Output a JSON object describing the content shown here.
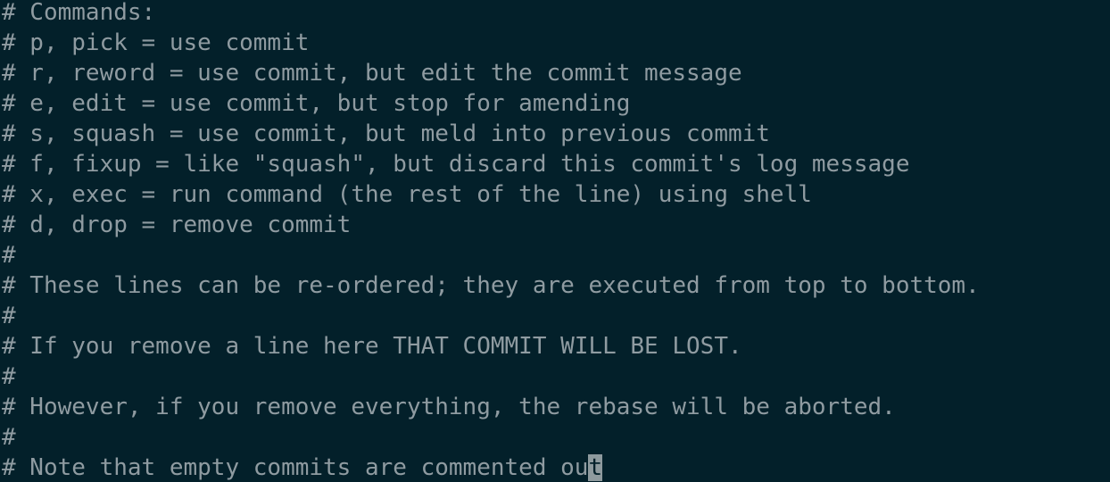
{
  "editor": {
    "lines": [
      "# Commands:",
      "# p, pick = use commit",
      "# r, reword = use commit, but edit the commit message",
      "# e, edit = use commit, but stop for amending",
      "# s, squash = use commit, but meld into previous commit",
      "# f, fixup = like \"squash\", but discard this commit's log message",
      "# x, exec = run command (the rest of the line) using shell",
      "# d, drop = remove commit",
      "#",
      "# These lines can be re-ordered; they are executed from top to bottom.",
      "#",
      "# If you remove a line here THAT COMMIT WILL BE LOST.",
      "#",
      "# However, if you remove everything, the rebase will be aborted.",
      "#"
    ],
    "last_line_before_cursor": "# Note that empty commits are commented ou",
    "cursor_char": "t",
    "colors": {
      "background": "#03202a",
      "text": "#8f9ba1",
      "cursor": "#8e9a9e"
    }
  }
}
